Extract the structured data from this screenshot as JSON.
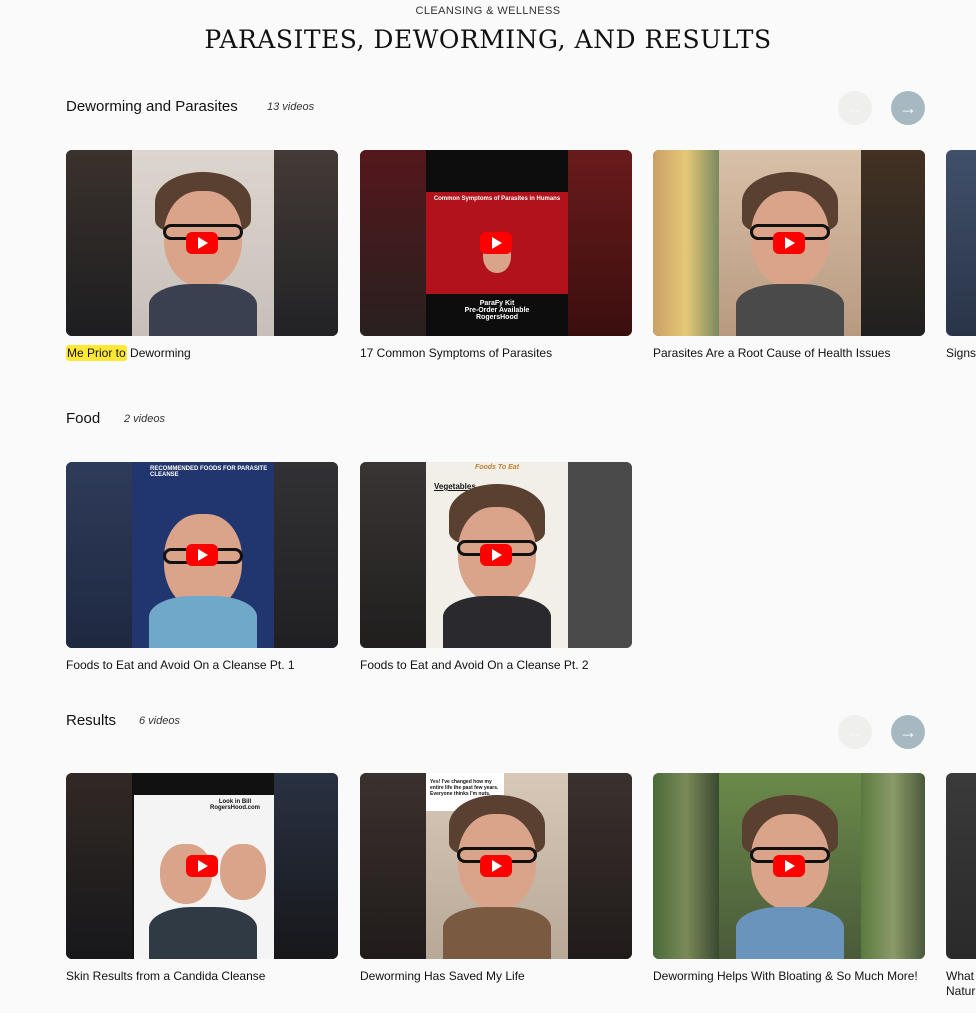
{
  "header": {
    "eyebrow": "CLEANSING & WELLNESS",
    "title": "PARASITES, DEWORMING, AND RESULTS"
  },
  "icons": {
    "prev": "arrow-left-icon",
    "next": "arrow-right-icon",
    "play": "youtube-play-icon"
  },
  "colors": {
    "play": "#ff0000",
    "nav_active": "#a8b8c2",
    "nav_disabled": "#efefee",
    "highlight": "#ffe936"
  },
  "sections": [
    {
      "title": "Deworming and Parasites",
      "count": "13 videos",
      "videos": [
        {
          "title_highlight": "Me Prior to",
          "title_rest": " Deworming",
          "overlay": ""
        },
        {
          "title": "17 Common Symptoms of Parasites",
          "overlay_title": "Common Symptoms of Parasites in Humans",
          "overlay_footer": "ParaFy Kit\nPre-Order Available\nRogersHood"
        },
        {
          "title": "Parasites Are a Root Cause of Health Issues"
        },
        {
          "title": "Signs"
        }
      ]
    },
    {
      "title": "Food",
      "count": "2 videos",
      "videos": [
        {
          "title": "Foods to Eat and Avoid On a Cleanse Pt. 1",
          "overlay_title": "RECOMMENDED FOODS FOR PARASITE CLEANSE"
        },
        {
          "title": "Foods to Eat and Avoid On a Cleanse Pt. 2",
          "overlay_title": "Foods To Eat",
          "overlay_sub": "Vegetables"
        }
      ]
    },
    {
      "title": "Results",
      "count": "6 videos",
      "videos": [
        {
          "title": "Skin Results from a Candida Cleanse",
          "overlay_title": "Look in Bill RogersHood.com"
        },
        {
          "title": "Deworming Has Saved My Life",
          "overlay_title": "Yes! I've changed how my entire life the past few years. Everyone thinks I'm nuts."
        },
        {
          "title": "Deworming Helps With Bloating & So Much More!"
        },
        {
          "title": "What Natur"
        }
      ]
    }
  ]
}
